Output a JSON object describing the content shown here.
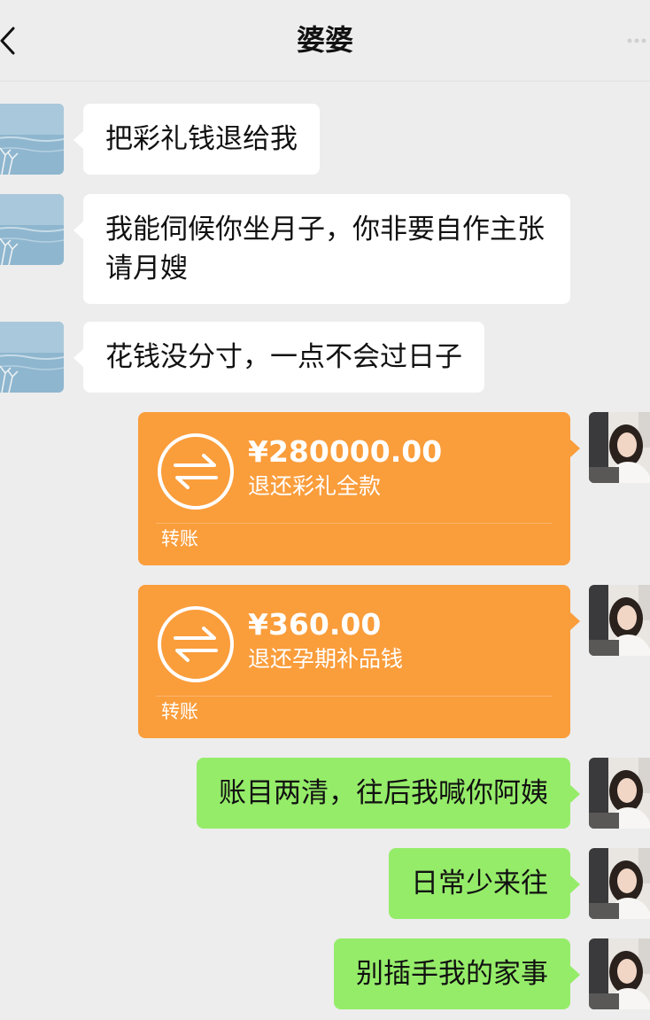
{
  "header": {
    "title": "婆婆",
    "back_icon": "chevron-left-icon",
    "more_icon": "more-icon"
  },
  "messages": [
    {
      "side": "left",
      "type": "text",
      "text": "把彩礼钱退给我"
    },
    {
      "side": "left",
      "type": "text",
      "text": " 我能伺候你坐月子，你非要自作主张请月嫂"
    },
    {
      "side": "left",
      "type": "text",
      "text": "花钱没分寸，一点不会过日子"
    },
    {
      "side": "right",
      "type": "transfer",
      "amount": "¥280000.00",
      "note": "退还彩礼全款",
      "label": "转账"
    },
    {
      "side": "right",
      "type": "transfer",
      "amount": "¥360.00",
      "note": "退还孕期补品钱",
      "label": "转账"
    },
    {
      "side": "right",
      "type": "text",
      "text": "账目两清，往后我喊你阿姨"
    },
    {
      "side": "right",
      "type": "text",
      "text": "日常少来往"
    },
    {
      "side": "right",
      "type": "text",
      "text": "别插手我的家事"
    }
  ],
  "colors": {
    "background": "#ededed",
    "incoming_bubble": "#ffffff",
    "outgoing_bubble": "#95ec69",
    "transfer_card": "#fa9d3b"
  },
  "icons": {
    "transfer": "transfer-arrows-icon",
    "left_avatar": "lake-landscape-avatar",
    "right_avatar": "woman-portrait-avatar"
  }
}
